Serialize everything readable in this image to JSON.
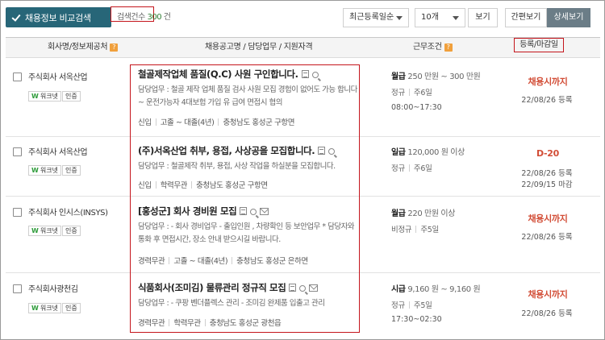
{
  "toolbar": {
    "compare_label": "채용정보 비교검색",
    "count_label": "검색건수",
    "count_value": "300",
    "count_unit": "건",
    "sort_selected": "최근등록일순",
    "page_size_selected": "10개",
    "view_button": "보기",
    "simple_view": "간편보기",
    "detail_view": "상세보기"
  },
  "columns": {
    "company": "회사명/정보제공처",
    "posting": "채용공고명 / 담당업무 / 지원자격",
    "conditions": "근무조건",
    "deadline": "등록/마감일",
    "help_mark": "?"
  },
  "colors": {
    "primary": "#276678",
    "status": "#d24d36",
    "highlight": "#c4151c",
    "badge_green": "#2e9b3a"
  },
  "rows": [
    {
      "company": "주식회사 서옥산업",
      "badge_source": "워크넷",
      "badge_cert": "인증",
      "title": "철골제작업체 품질(Q.C) 사원 구인합니다.",
      "duty": "담당업무 : 철골 제작 업체 품질 검사 사원 모집 경험이 없어도 가능 합니다 ~ 운전가능자 4대보험 가입 유 급여 면접시 협의",
      "career": "신입",
      "education": "고졸 ~ 대졸(4년)",
      "location": "충청남도 홍성군 구항면",
      "pay_type": "월급",
      "pay": "250 만원 ~ 300 만원",
      "employment": "정규",
      "week": "주6일",
      "time": "08:00~17:30",
      "status": "채용시까지",
      "reg_date": "22/08/26 등록",
      "end_date": ""
    },
    {
      "company": "주식회사 서옥산업",
      "badge_source": "워크넷",
      "badge_cert": "인증",
      "title": "(주)서옥산업 취부, 용접, 사상공을 모집합니다.",
      "duty": "담당업무 : 철골제작 취부, 용접, 사상 작업을 하실분을 모집합니다.",
      "career": "신입",
      "education": "학력무관",
      "location": "충청남도 홍성군 구항면",
      "pay_type": "일급",
      "pay": "120,000 원 이상",
      "employment": "정규",
      "week": "주6일",
      "time": "",
      "status": "D-20",
      "reg_date": "22/08/26 등록",
      "end_date": "22/09/15 마감"
    },
    {
      "company": "주식회사 인시스(INSYS)",
      "badge_source": "워크넷",
      "badge_cert": "인증",
      "title": "[홍성군] 회사 경비원 모집",
      "duty": "담당업무 : - 회사 경비업무 - 출입인원 , 차량확인 등 보안업무 * 담당자와 통화 후 면접시간, 장소 안내 받으시길 바랍니다.",
      "career": "경력무관",
      "education": "고졸 ~ 대졸(4년)",
      "location": "충청남도 홍성군 은하면",
      "pay_type": "월급",
      "pay": "220 만원 이상",
      "employment": "비정규",
      "week": "주5일",
      "time": "",
      "status": "채용시까지",
      "reg_date": "22/08/26 등록",
      "end_date": ""
    },
    {
      "company": "주식회사광천김",
      "badge_source": "워크넷",
      "badge_cert": "인증",
      "title": "식품회사(조미김) 물류관리 정규직 모집",
      "duty": "담당업무 : - 쿠팡 벤더플렉스 관리 - 조미김 완제품 입출고 관리",
      "career": "경력무관",
      "education": "학력무관",
      "location": "충청남도 홍성군 광천읍",
      "pay_type": "시급",
      "pay": "9,160 원 ~ 9,160 원",
      "employment": "정규",
      "week": "주5일",
      "time": "17:30~02:30",
      "status": "채용시까지",
      "reg_date": "22/08/26 등록",
      "end_date": ""
    }
  ]
}
